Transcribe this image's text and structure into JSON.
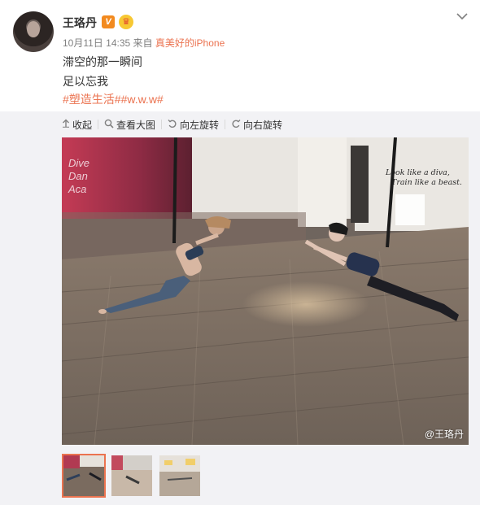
{
  "post": {
    "author": "王珞丹",
    "verified_badge": "V",
    "crown_badge": "♛",
    "time": "10月11日 14:35",
    "source_prefix": "来自",
    "source": "真美好的iPhone",
    "lines": [
      "滞空的那一瞬间",
      "足以忘我"
    ],
    "tags": [
      "#塑造生活#",
      "#w.w.w#"
    ]
  },
  "toolbar": {
    "collapse": "收起",
    "view_large": "查看大图",
    "rotate_left": "向左旋转",
    "rotate_right": "向右旋转"
  },
  "photo": {
    "wall_text_left": [
      "Dive",
      "Dan",
      "Aca"
    ],
    "wall_text_right": [
      "Look like a diva,",
      "Train like a beast."
    ],
    "watermark": "@王珞丹"
  },
  "icons": {
    "menu": "chevron-down-icon",
    "collapse": "arrow-up-icon",
    "view_large": "magnifier-icon",
    "rotate_left": "rotate-left-icon",
    "rotate_right": "rotate-right-icon"
  },
  "colors": {
    "accent": "#eb7350",
    "verified": "#f28a1f",
    "muted": "#808080"
  }
}
